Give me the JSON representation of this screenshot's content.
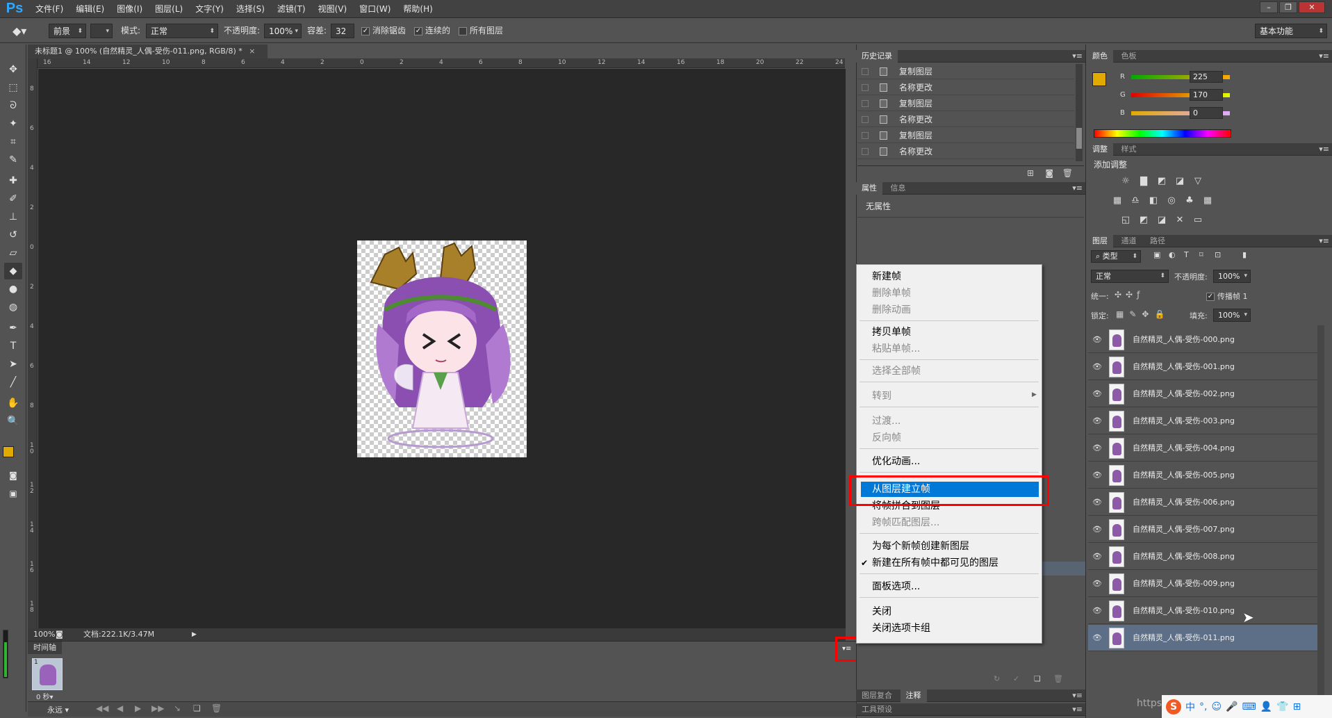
{
  "app": {
    "logo": "Ps",
    "menu": [
      "文件(F)",
      "编辑(E)",
      "图像(I)",
      "图层(L)",
      "文字(Y)",
      "选择(S)",
      "滤镜(T)",
      "视图(V)",
      "窗口(W)",
      "帮助(H)"
    ],
    "window_controls": [
      "minimize-icon",
      "restore-icon",
      "close-icon"
    ]
  },
  "options_bar": {
    "fill_source": "前景",
    "mode_label": "模式:",
    "mode_value": "正常",
    "opacity_label": "不透明度:",
    "opacity_value": "100%",
    "tolerance_label": "容差:",
    "tolerance_value": "32",
    "antialias": "消除锯齿",
    "contiguous": "连续的",
    "all_layers": "所有图层",
    "workspace": "基本功能"
  },
  "document": {
    "tab_title": "未标题1 @ 100% (自然精灵_人偶-受伤-011.png, RGB/8) *",
    "zoom": "100%",
    "doc_size": "文档:222.1K/3.47M",
    "ruler_h": [
      "16",
      "14",
      "12",
      "10",
      "8",
      "6",
      "4",
      "2",
      "0",
      "2",
      "4",
      "6",
      "8",
      "10",
      "12",
      "14",
      "16",
      "18",
      "20",
      "22",
      "24"
    ],
    "ruler_v": [
      "8",
      "6",
      "4",
      "2",
      "0",
      "2",
      "4",
      "6",
      "8",
      "1 0",
      "1 2",
      "1 4",
      "1 6",
      "1 8"
    ]
  },
  "timeline": {
    "tab": "时间轴",
    "frame_number": "1",
    "frame_delay": "0 秒▾",
    "loop": "永远"
  },
  "history_panel": {
    "tabs": [
      "历史记录"
    ],
    "items": [
      "复制图层",
      "名称更改",
      "复制图层",
      "名称更改",
      "复制图层",
      "名称更改"
    ]
  },
  "properties_panel": {
    "tabs": [
      "属性",
      "信息"
    ],
    "text": "无属性"
  },
  "bottom_tabs": {
    "group1": [
      "图层复合",
      "注释"
    ],
    "group2": [
      "工具预设"
    ]
  },
  "context_menu": {
    "items": [
      {
        "label": "新建帧",
        "enabled": true
      },
      {
        "label": "删除单帧",
        "enabled": false
      },
      {
        "label": "删除动画",
        "enabled": false
      },
      {
        "label": "拷贝单帧",
        "enabled": true
      },
      {
        "label": "粘贴单帧...",
        "enabled": false
      },
      {
        "label": "选择全部帧",
        "enabled": false
      },
      {
        "label": "转到",
        "enabled": false
      },
      {
        "label": "过渡...",
        "enabled": false
      },
      {
        "label": "反向帧",
        "enabled": false
      },
      {
        "label": "优化动画...",
        "enabled": true
      },
      {
        "label": "从图层建立帧",
        "enabled": true,
        "highlighted": true
      },
      {
        "label": "将帧拼合到图层",
        "enabled": true
      },
      {
        "label": "跨帧匹配图层...",
        "enabled": false
      },
      {
        "label": "为每个新帧创建新图层",
        "enabled": true
      },
      {
        "label": "新建在所有帧中都可见的图层",
        "enabled": true,
        "checked": true
      },
      {
        "label": "面板选项...",
        "enabled": true
      },
      {
        "label": "关闭",
        "enabled": true
      },
      {
        "label": "关闭选项卡组",
        "enabled": true
      }
    ]
  },
  "color_panel": {
    "tabs": [
      "颜色",
      "色板"
    ],
    "r_label": "R",
    "r_value": "225",
    "g_label": "G",
    "g_value": "170",
    "b_label": "B",
    "b_value": "0",
    "foreground": "#e1aa00"
  },
  "adjustments_panel": {
    "tabs": [
      "调整",
      "样式"
    ],
    "title": "添加调整"
  },
  "layers_panel": {
    "tabs": [
      "图层",
      "通道",
      "路径"
    ],
    "kind_filter": "类型",
    "blend_mode": "正常",
    "opacity_label": "不透明度:",
    "opacity_value": "100%",
    "unify_label": "统一:",
    "propagate_label": "传播帧 1",
    "lock_label": "锁定:",
    "fill_label": "填充:",
    "fill_value": "100%",
    "layers": [
      "自然精灵_人偶-受伤-000.png",
      "自然精灵_人偶-受伤-001.png",
      "自然精灵_人偶-受伤-002.png",
      "自然精灵_人偶-受伤-003.png",
      "自然精灵_人偶-受伤-004.png",
      "自然精灵_人偶-受伤-005.png",
      "自然精灵_人偶-受伤-006.png",
      "自然精灵_人偶-受伤-007.png",
      "自然精灵_人偶-受伤-008.png",
      "自然精灵_人偶-受伤-009.png",
      "自然精灵_人偶-受伤-010.png",
      "自然精灵_人偶-受伤-011.png"
    ],
    "selected_index": 11
  },
  "ime": {
    "logo": "S",
    "items": [
      "中",
      "°,",
      "☺",
      "🎤",
      "⌨",
      "👤",
      "👕",
      "⊞"
    ],
    "watermark": "https"
  }
}
